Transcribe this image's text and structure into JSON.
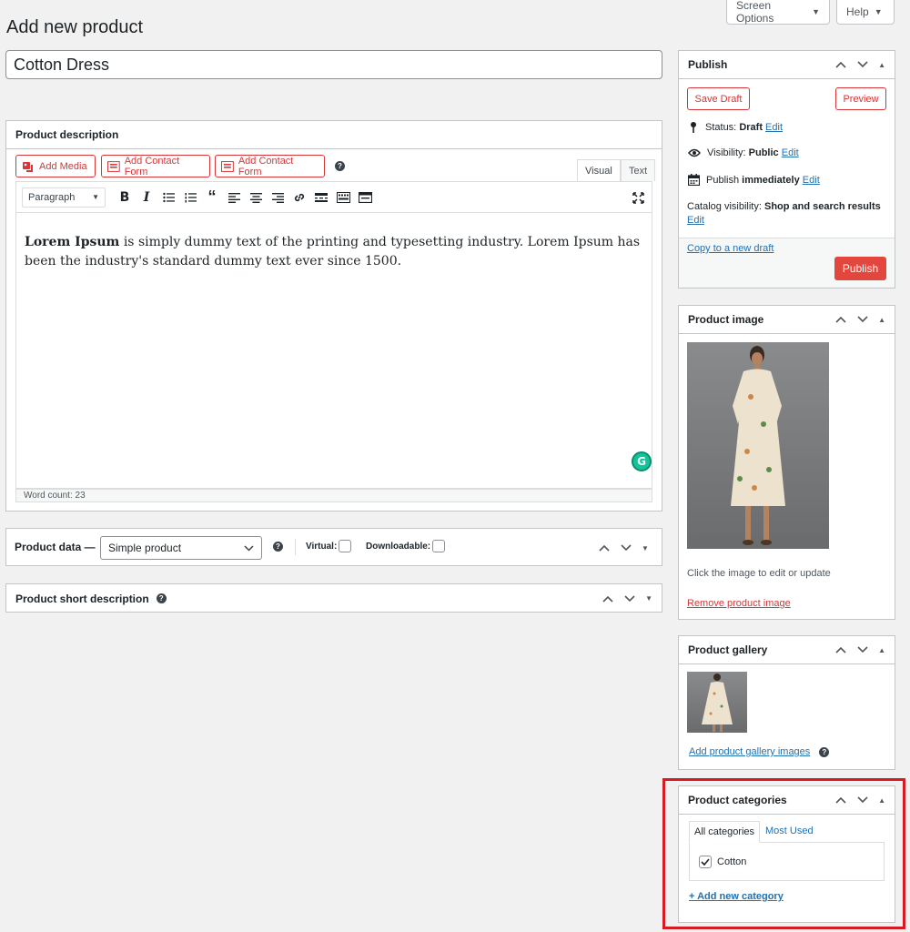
{
  "header": {
    "screen_options": "Screen Options",
    "help": "Help",
    "page_title": "Add new product"
  },
  "title_input": {
    "value": "Cotton Dress"
  },
  "description": {
    "heading": "Product description",
    "add_media": "Add Media",
    "add_contact_form_1": "Add Contact Form",
    "add_contact_form_2": "Add Contact Form",
    "tab_visual": "Visual",
    "tab_text": "Text",
    "format_select": "Paragraph",
    "content_bold": "Lorem Ipsum",
    "content_rest": " is simply dummy text of the printing and typesetting industry. Lorem Ipsum has been the industry's standard dummy text ever since 1500.",
    "word_count": "Word count: 23"
  },
  "product_data": {
    "label": "Product data —",
    "type_select": "Simple product",
    "virtual": "Virtual:",
    "downloadable": "Downloadable:"
  },
  "short_description": {
    "heading": "Product short description"
  },
  "publish": {
    "heading": "Publish",
    "save_draft": "Save Draft",
    "preview": "Preview",
    "status_label": "Status:",
    "status_value": "Draft",
    "visibility_label": "Visibility:",
    "visibility_value": "Public",
    "publish_label": "Publish",
    "publish_value": "immediately",
    "edit": "Edit",
    "catalog_label": "Catalog visibility:",
    "catalog_value": "Shop and search results",
    "copy_draft": "Copy to a new draft",
    "publish_button": "Publish"
  },
  "product_image": {
    "heading": "Product image",
    "caption": "Click the image to edit or update",
    "remove": "Remove product image"
  },
  "product_gallery": {
    "heading": "Product gallery",
    "add_images": "Add product gallery images"
  },
  "product_categories": {
    "heading": "Product categories",
    "tab_all": "All categories",
    "tab_most_used": "Most Used",
    "items": [
      {
        "label": "Cotton",
        "checked": true
      }
    ],
    "add_new": "+ Add new category"
  },
  "colors": {
    "accent_red": "#d63638",
    "publish_bg": "#e2463c",
    "link": "#2271b1",
    "highlight": "#d81b21"
  }
}
